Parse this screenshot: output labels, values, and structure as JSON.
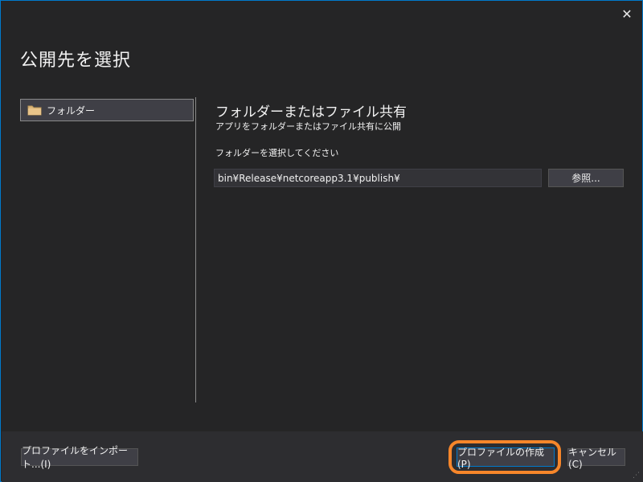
{
  "window": {
    "title": "公開先を選択",
    "close_label": "✕"
  },
  "sidebar": {
    "items": [
      {
        "label": "フォルダー",
        "icon": "folder-icon"
      }
    ]
  },
  "panel": {
    "title": "フォルダーまたはファイル共有",
    "subtitle": "アプリをフォルダーまたはファイル共有に公開",
    "field_label": "フォルダーを選択してください",
    "folder_path": "bin¥Release¥netcoreapp3.1¥publish¥",
    "browse_label": "参照..."
  },
  "footer": {
    "import_label": "プロファイルをインポート...(I)",
    "create_label": "プロファイルの作成(P)",
    "cancel_label": "キャンセル(C)"
  },
  "colors": {
    "accent": "#007acc",
    "highlight_ring": "#f7862a",
    "folder_icon": "#dcb67a"
  }
}
